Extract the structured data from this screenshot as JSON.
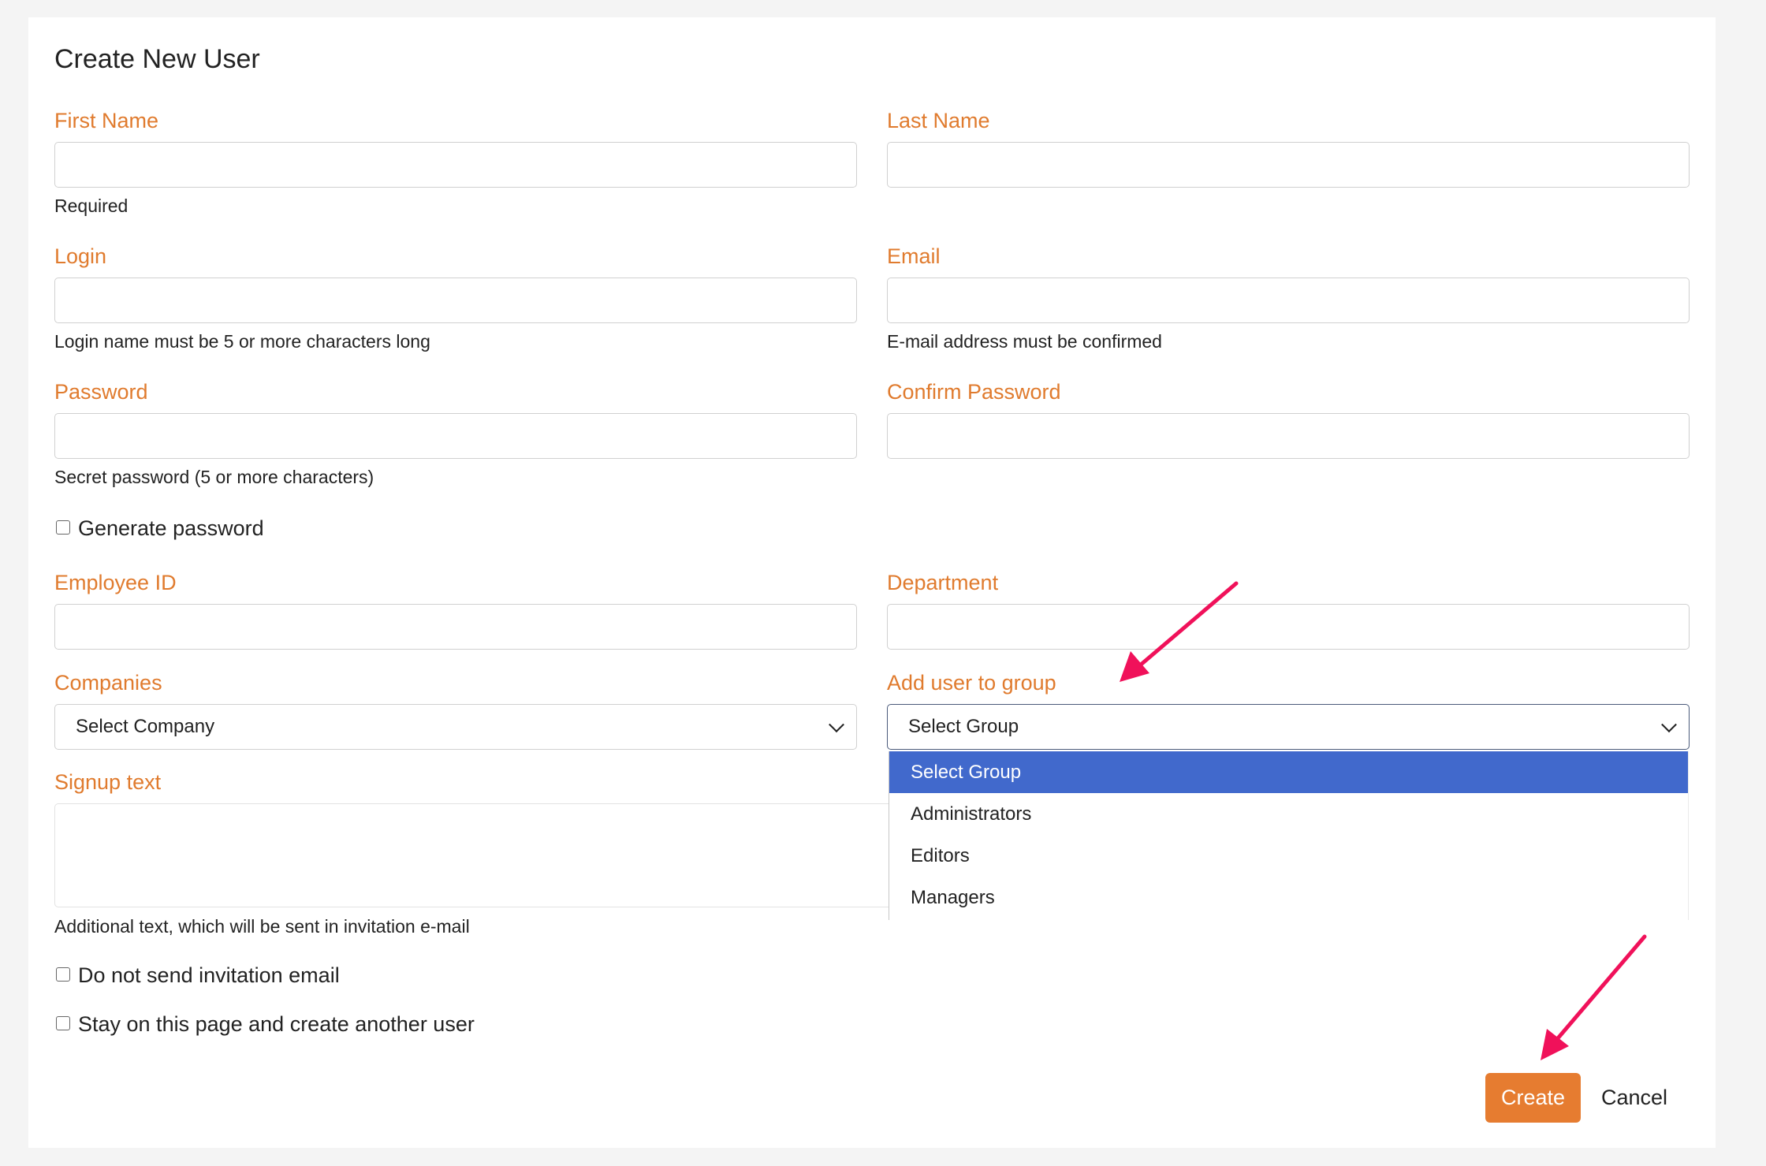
{
  "form": {
    "title": "Create New User",
    "first_name": {
      "label": "First Name",
      "help": "Required",
      "value": ""
    },
    "last_name": {
      "label": "Last Name",
      "value": ""
    },
    "login": {
      "label": "Login",
      "help": "Login name must be 5 or more characters long",
      "value": ""
    },
    "email": {
      "label": "Email",
      "help": "E-mail address must be confirmed",
      "value": ""
    },
    "password": {
      "label": "Password",
      "help": "Secret password (5 or more characters)",
      "value": ""
    },
    "confirm_password": {
      "label": "Confirm Password",
      "value": ""
    },
    "generate_password": {
      "label": "Generate password",
      "checked": false
    },
    "employee_id": {
      "label": "Employee ID",
      "value": ""
    },
    "department": {
      "label": "Department",
      "value": ""
    },
    "companies": {
      "label": "Companies",
      "selected": "Select Company"
    },
    "group": {
      "label": "Add user to group",
      "selected": "Select Group",
      "options": [
        "Select Group",
        "Administrators",
        "Editors",
        "Managers"
      ]
    },
    "signup_text": {
      "label": "Signup text",
      "help": "Additional text, which will be sent in invitation e-mail",
      "value": ""
    },
    "no_invitation": {
      "label": "Do not send invitation email",
      "checked": false
    },
    "stay_on_page": {
      "label": "Stay on this page and create another user",
      "checked": false
    },
    "create_label": "Create",
    "cancel_label": "Cancel"
  },
  "colors": {
    "label": "#e07b2e",
    "primary_button": "#e67c30",
    "dropdown_highlight": "#4169cc",
    "annotation_arrow": "#f0115a"
  }
}
